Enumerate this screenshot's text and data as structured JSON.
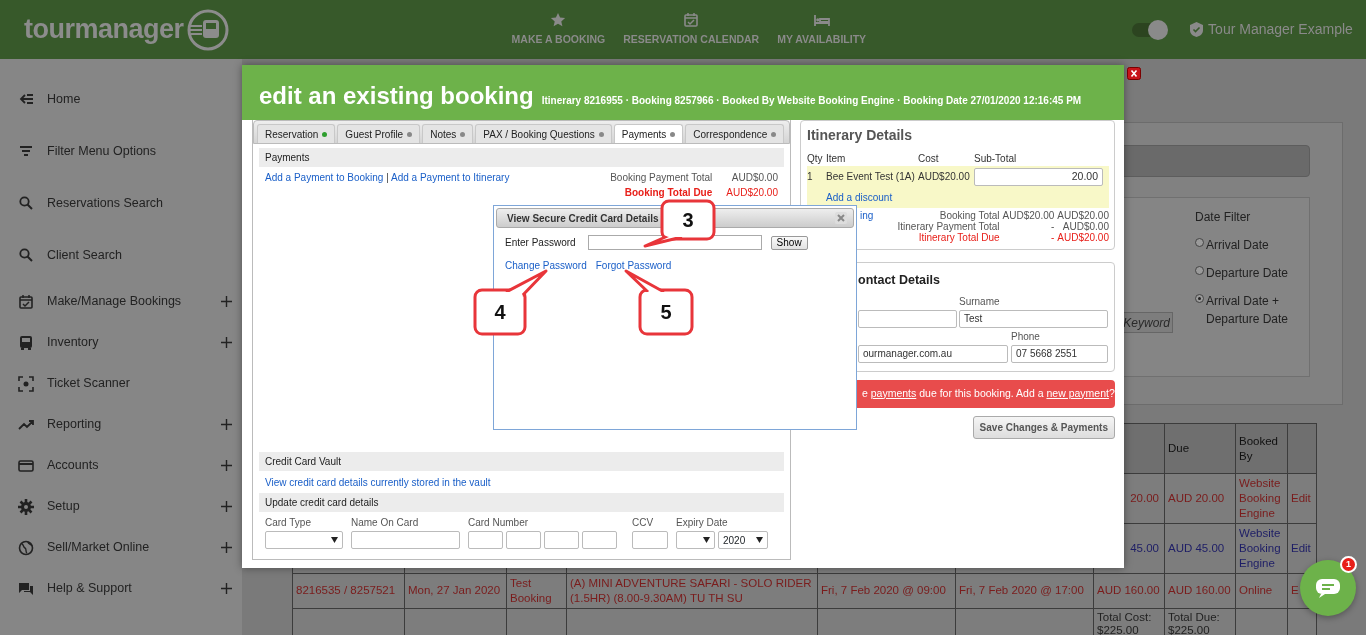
{
  "header": {
    "logo": "tourmanager",
    "nav": [
      {
        "label": "MAKE A BOOKING"
      },
      {
        "label": "RESERVATION CALENDAR"
      },
      {
        "label": "MY AVAILABILITY"
      }
    ],
    "theme_toggle": {
      "on": true
    },
    "account": "Tour Manager Example"
  },
  "sidebar": {
    "items": [
      {
        "label": "Home",
        "expandable": false
      },
      {
        "label": "Filter Menu Options",
        "expandable": false
      },
      {
        "label": "Reservations Search",
        "expandable": false
      },
      {
        "label": "Client Search",
        "expandable": false
      },
      {
        "label": "Make/Manage Bookings",
        "expandable": true
      },
      {
        "label": "Inventory",
        "expandable": true
      },
      {
        "label": "Ticket Scanner",
        "expandable": false
      },
      {
        "label": "Reporting",
        "expandable": true
      },
      {
        "label": "Accounts",
        "expandable": true
      },
      {
        "label": "Setup",
        "expandable": true
      },
      {
        "label": "Sell/Market Online",
        "expandable": true
      },
      {
        "label": "Help & Support",
        "expandable": true
      }
    ]
  },
  "filter_panel": {
    "keyword": {
      "placeholder": "Keyword"
    },
    "title": "Date Filter",
    "options": [
      {
        "label": "Arrival Date",
        "selected": false
      },
      {
        "label": "Departure Date",
        "selected": false
      },
      {
        "label": "Arrival Date + Departure Date",
        "selected": true
      }
    ]
  },
  "bookings_table": {
    "header": {
      "column_8": "Due",
      "column_9": "Booked By"
    },
    "rows": [
      {
        "color": "#7a1c1c",
        "cells": {
          "column_7": "20.00",
          "column_8": "AUD 20.00",
          "column_9": "Website Booking Engine",
          "column_10": "Edit"
        }
      },
      {
        "color": "#1e1e66",
        "cells": {
          "column_7": "45.00",
          "column_8": "AUD 45.00",
          "column_9": "Website Booking Engine",
          "column_10": "Edit"
        }
      },
      {
        "color": "#7a1c1c",
        "cells": {
          "column_1": "8216535 / 8257521",
          "column_2": "Mon, 27 Jan 2020",
          "column_3": "Test Booking",
          "column_4": "(A) MINI ADVENTURE SAFARI - SOLO RIDER (1.5HR) (8.00-9.30AM) TU TH SU",
          "column_5": "Fri, 7 Feb 2020 @ 09:00",
          "column_6": "Fri, 7 Feb 2020 @ 17:00",
          "column_7": "AUD 160.00",
          "column_8": "AUD 160.00",
          "column_9": "Online",
          "column_10": "E"
        }
      },
      {
        "color": "#222222",
        "cells": {
          "column_7": "Total Cost: $225.00",
          "column_8": "Total Due: $225.00"
        }
      }
    ]
  },
  "booking_modal": {
    "title": "edit an existing booking",
    "subtitle": "Itinerary 8216955 · Booking 8257966 · Booked By Website Booking Engine · Booking Date 27/01/2020 12:16:45 PM",
    "tabs": [
      {
        "label": "Reservation",
        "selected": false,
        "color": "#2e9e2e"
      },
      {
        "label": "Guest Profile",
        "selected": false,
        "color": "#888888"
      },
      {
        "label": "Notes",
        "selected": false,
        "color": "#888888"
      },
      {
        "label": "PAX / Booking Questions",
        "selected": false,
        "color": "#888888"
      },
      {
        "label": "Payments",
        "selected": true,
        "color": "#888888"
      },
      {
        "label": "Correspondence",
        "selected": false,
        "color": "#888888"
      }
    ],
    "payments": {
      "heading": "Payments",
      "links": [
        "Add a Payment to Booking",
        "Add a Payment to Itinerary"
      ],
      "separator": "|",
      "totals": [
        {
          "label": "Booking Payment Total",
          "value": "AUD$0.00",
          "kind": "normal"
        },
        {
          "label": "Booking Total Due",
          "value": "AUD$20.00",
          "kind": "due"
        }
      ]
    },
    "vault": {
      "heading": "Credit Card Vault",
      "link": "View credit card details currently stored in the vault"
    },
    "card_update": {
      "heading": "Update credit card details",
      "fields": [
        {
          "label": "Card Type",
          "kind": "select"
        },
        {
          "label": "Name On Card",
          "kind": "text"
        },
        {
          "label": "Card Number",
          "kind": "card-number"
        },
        {
          "label": "CCV",
          "kind": "ccv"
        },
        {
          "label": "Expiry Date",
          "kind": "expiry",
          "year": "2020"
        }
      ]
    },
    "itinerary": {
      "title": "Itinerary Details",
      "columns": [
        "Qty",
        "Item",
        "Cost",
        "Sub-Total"
      ],
      "item": {
        "qty": "1",
        "name": "Bee Event Test (1A)",
        "cost": "AUD$20.00",
        "subtotal": "20.00",
        "discount_link": "Add a discount"
      },
      "totals": [
        {
          "link": "ing",
          "label": "Booking Total",
          "middle": "AUD$20.00",
          "value": "AUD$20.00",
          "kind": "normal"
        },
        {
          "label": "Itinerary Payment Total",
          "middle": "-",
          "value": "AUD$0.00",
          "kind": "normal"
        },
        {
          "label": "Itinerary Total Due",
          "middle": "-",
          "value": "AUD$20.00",
          "kind": "due"
        }
      ]
    },
    "contact": {
      "title": "ontact Details",
      "surname_label": "Surname",
      "surname": "Test",
      "email": "ourmanager.com.au",
      "phone_label": "Phone",
      "phone": "07 5668 2551"
    },
    "alert": {
      "before": "e ",
      "link1": "payments",
      "middle": " due for this booking. Add a ",
      "link2": "new payment",
      "after": "?"
    },
    "save_button": "Save Changes & Payments"
  },
  "secure_dialog": {
    "title": "View Secure Credit Card Details",
    "password_label": "Enter Password",
    "show_button": "Show",
    "links": [
      "Change Password",
      "Forgot Password"
    ]
  },
  "callouts": [
    {
      "number": "3"
    },
    {
      "number": "4"
    },
    {
      "number": "5"
    }
  ],
  "chat": {
    "badge": "1"
  }
}
